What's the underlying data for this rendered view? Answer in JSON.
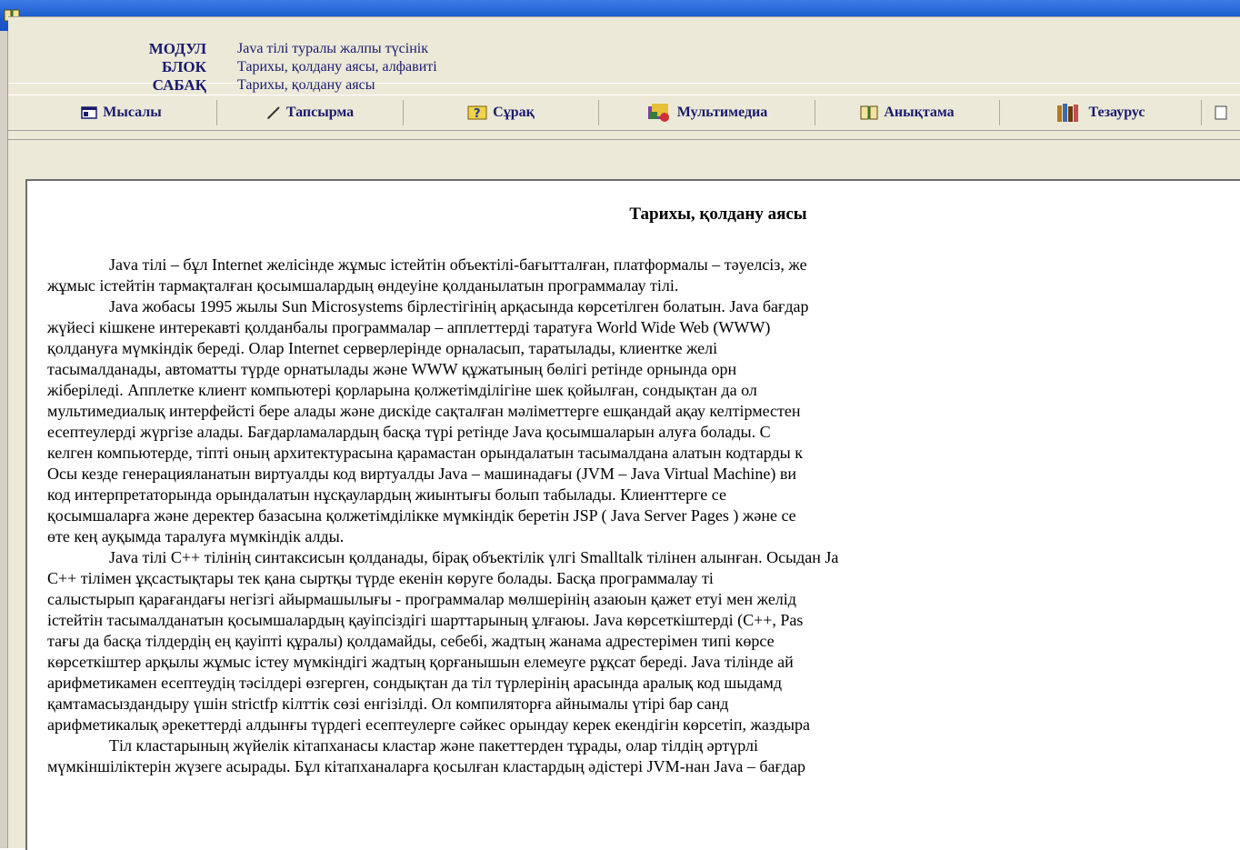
{
  "window": {
    "icon": "book-icon"
  },
  "header": {
    "rows": [
      {
        "key": "МОДУЛ",
        "value": "Java тілі туралы жалпы түсінік"
      },
      {
        "key": "БЛОК",
        "value": "Тарихы, қолдану аясы, алфавиті"
      },
      {
        "key": "САБАҚ",
        "value": "Тарихы, қолдану аясы"
      }
    ]
  },
  "toolbar": {
    "buttons": [
      {
        "label": "Мысалы",
        "icon": "window-icon"
      },
      {
        "label": "Тапсырма",
        "icon": "pen-icon"
      },
      {
        "label": "Сұрақ",
        "icon": "question-icon"
      },
      {
        "label": "Мультимедиа",
        "icon": "multimedia-icon"
      },
      {
        "label": "Анықтама",
        "icon": "book-icon"
      },
      {
        "label": "Тезаурус",
        "icon": "books-icon"
      }
    ]
  },
  "content": {
    "title": "Тарихы, қолдану аясы",
    "lines": [
      "Java тілі – бұл Internet желісінде жұмыс істейтін объектілі-бағытталған, платформалы – тәуелсіз, же",
      "жұмыс істейтін тармақталған қосымшалардың өндеуіне қолданылатын программалау тілі.",
      "Java жобасы 1995 жылы Sun Microsystems бірлестігінің арқасында көрсетілген болатын. Java бағдар",
      "жүйесі кішкене интерекавті қолданбалы программалар – апплеттерді таратуға World Wide Web (WWW)",
      "қолдануға мүмкіндік береді. Олар Internet серверлерінде орналасып, таратылады, клиентке желі",
      "тасымалданады, автоматты түрде орнатылады және WWW құжатының бөлігі ретінде орнында орн",
      "жіберіледі. Апплетке клиент компьютері қорларына қолжетімділігіне шек қойылған, сондықтан да ол",
      "мультимедиалық интерфейсті бере алады және дискіде сақталған мәліметтерге ешқандай ақау келтірместен",
      "есептеулерді жүргізе алады. Бағдарламалардың басқа түрі ретінде Java қосымшаларын алуға болады. С",
      "келген компьютерде, тіпті оның архитектурасына қарамастан орындалатын тасымалдана алатын кодтарды к",
      "Осы кезде генерацияланатын виртуалды код виртуалды Java – машинадағы (JVM – Java Virtual Machine) ви",
      "код интерпретаторында орындалатын нұсқаулардың жиынтығы болып табылады. Клиенттерге се",
      "қосымшаларға және деректер базасына қолжетімділікке мүмкіндік беретін JSP ( Java Server Pages ) және се",
      "өте кең ауқымда таралуға мүмкіндік алды.",
      "Java тілі C++ тілінің синтаксисын қолданады, бірақ объектілік үлгі Smalltalk тілінен алынған. Осыдан Ja",
      "C++ тілімен ұқсастықтары тек қана сыртқы түрде екенін көруге болады. Басқа программалау ті",
      "салыстырып қарағандағы негізгі айырмашылығы - программалар мөлшерінің азаюын қажет етуі мен желід",
      "істейтін тасымалданатын қосымшалардың қауіпсіздігі шарттарының ұлғаюы. Java көрсеткіштерді (C++, Pas",
      "тағы да басқа тілдердің ең қауіпті құралы) қолдамайды, себебі, жадтың жанама адрестерімен типі көрсе",
      "көрсеткіштер арқылы жұмыс істеу мүмкіндігі жадтың қорғанышын елемеуге рұқсат береді. Java тілінде ай",
      "арифметикамен есептеудің тәсілдері өзгерген, сондықтан да тіл түрлерінің арасында аралық код шыдамд",
      "қамтамасыздандыру үшін strictfp кілттік сөзі енгізілді. Ол компиляторға айнымалы үтірі бар санд",
      "арифметикалық әрекеттерді алдынғы түрдегі есептеулерге сәйкес орындау керек екендігін көрсетіп, жаздыра",
      "Тіл кластарының жүйелік кітапханасы кластар және пакеттерден тұрады, олар тілдің әртүрлі",
      "мүмкіншіліктерін жүзеге асырады. Бұл кітапханаларға қосылған кластардың әдістері JVM-нан Java – бағдар"
    ]
  }
}
